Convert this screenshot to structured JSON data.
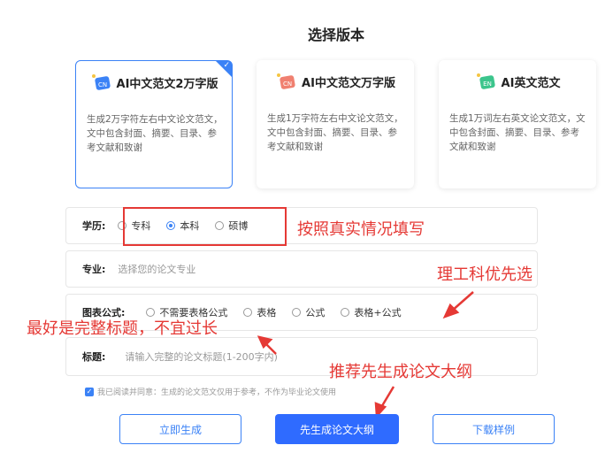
{
  "page": {
    "title": "选择版本"
  },
  "cards": [
    {
      "label": "AI中文范文2万字版",
      "badge": "CN",
      "desc": "生成2万字符左右中文论文范文，文中包含封面、摘要、目录、参考文献和致谢",
      "selected": true
    },
    {
      "label": "AI中文范文万字版",
      "badge": "CN",
      "desc": "生成1万字符左右中文论文范文，文中包含封面、摘要、目录、参考文献和致谢",
      "selected": false
    },
    {
      "label": "AI英文范文",
      "badge": "EN",
      "desc": "生成1万词左右英文论文范文，文中包含封面、摘要、目录、参考文献和致谢",
      "selected": false
    }
  ],
  "form": {
    "education": {
      "label": "学历:",
      "options": [
        "专科",
        "本科",
        "硕博"
      ],
      "selected": "本科"
    },
    "major": {
      "label": "专业:",
      "placeholder": "选择您的论文专业"
    },
    "chart": {
      "label": "图表公式:",
      "options": [
        "不需要表格公式",
        "表格",
        "公式",
        "表格+公式"
      ]
    },
    "topic": {
      "label": "标题:",
      "placeholder": "请输入完整的论文标题(1-200字内)"
    }
  },
  "agreement": "我已阅读并同意：生成的论文范文仅用于参考，不作为毕业论文使用",
  "buttons": {
    "generate": "立即生成",
    "outline": "先生成论文大纲",
    "download": "下载样例"
  },
  "annotations": {
    "fill_truthfully": "按照真实情况填写",
    "stem_first": "理工科优先选",
    "full_title": "最好是完整标题，不宜过长",
    "outline_first": "推荐先生成论文大纲"
  },
  "colors": {
    "accent": "#3b82f6",
    "annotation": "#e53935",
    "primary_button": "#2f6bff"
  }
}
